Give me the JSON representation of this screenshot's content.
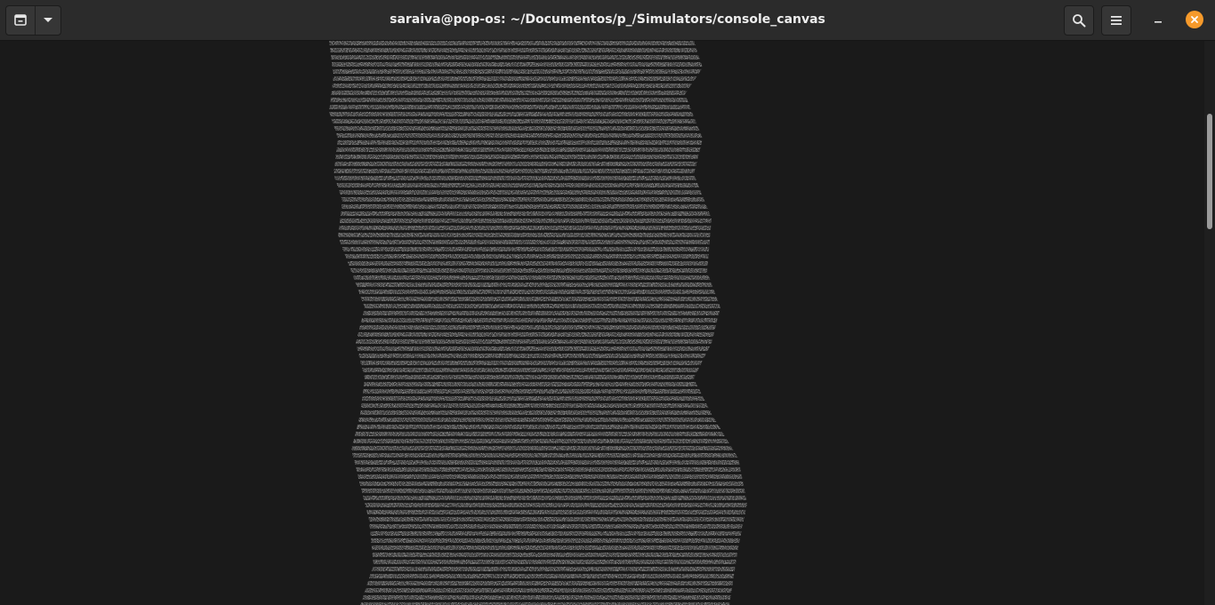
{
  "window": {
    "title": "saraiva@pop-os: ~/Documentos/p_/Simulators/console_canvas"
  },
  "header": {
    "new_tab_icon": "new-tab-icon",
    "tab_menu_icon": "chevron-down-icon",
    "search_icon": "search-icon",
    "menu_icon": "hamburger-menu-icon",
    "minimize_icon": "minimize-icon",
    "close_icon": "close-icon"
  },
  "colors": {
    "terminal_bg": "#1a1a1a",
    "header_bg": "#2b2b2b",
    "text": "#e6e6e6",
    "close_accent": "#f69a2b"
  },
  "terminal": {
    "content_type": "ascii-art-image"
  }
}
